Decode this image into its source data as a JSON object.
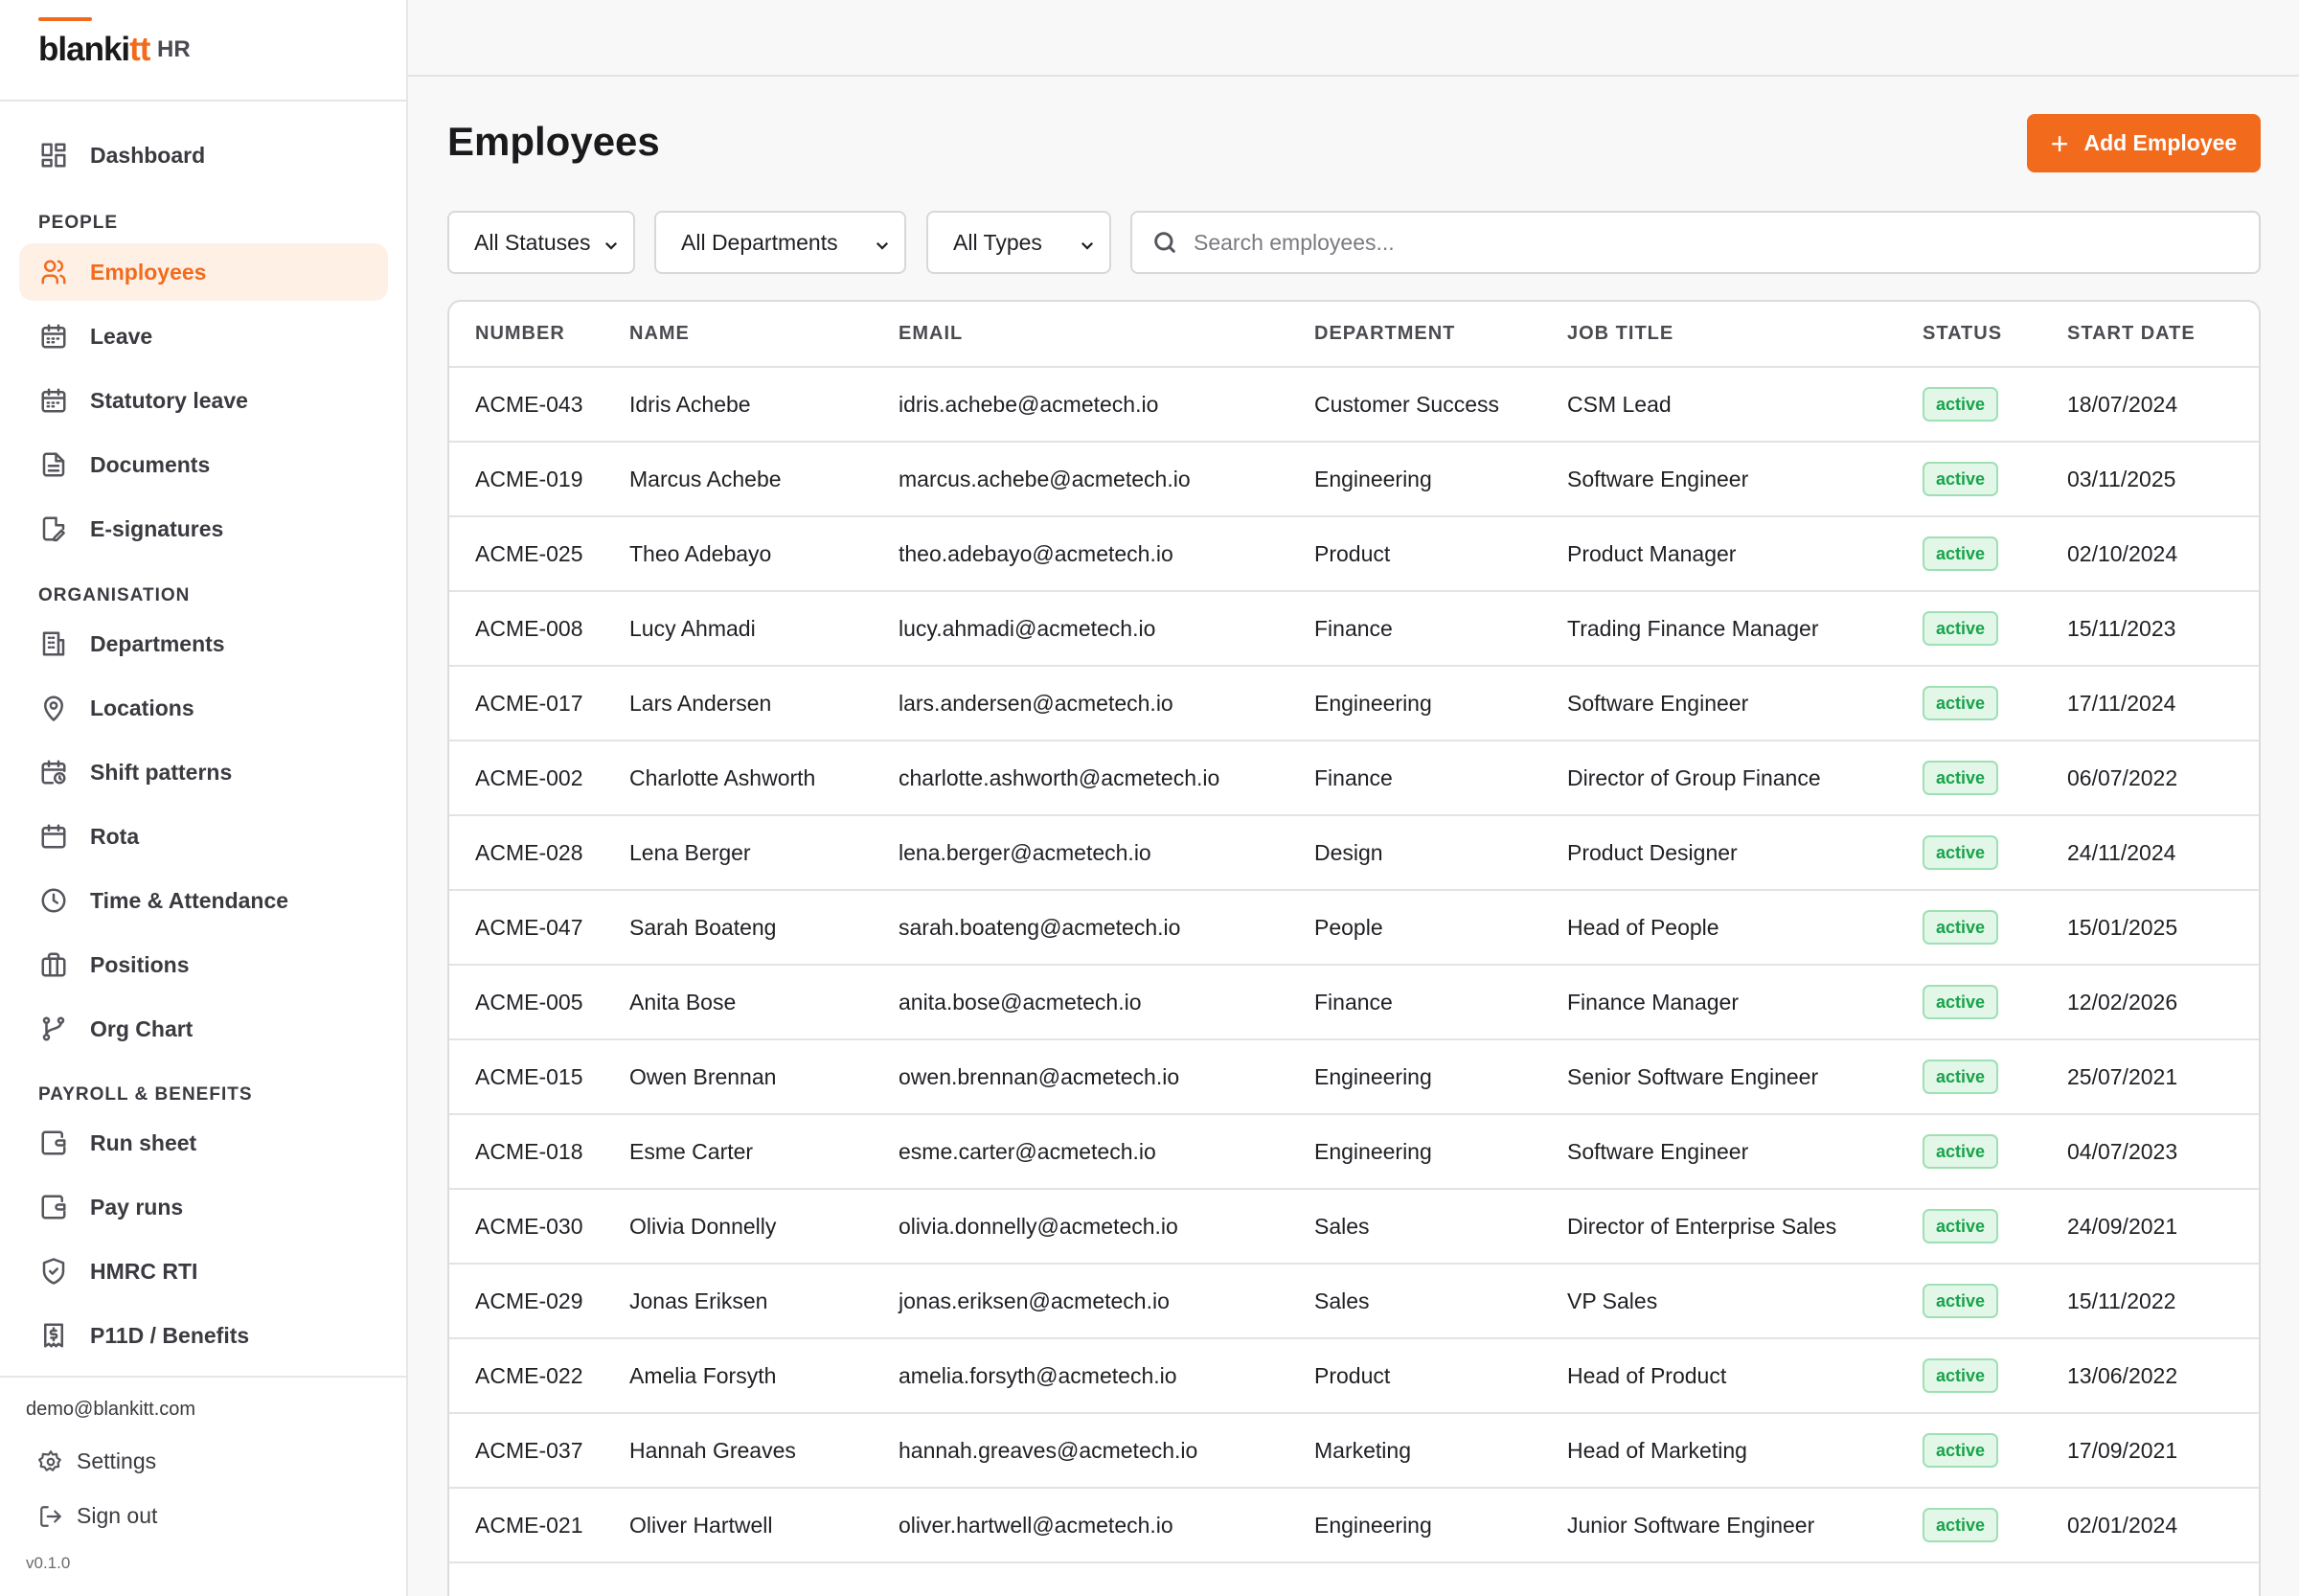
{
  "brand": {
    "logo_main": "blanki",
    "logo_accent": "tt",
    "suffix": "HR"
  },
  "sidebar": {
    "dashboard": "Dashboard",
    "sections": {
      "people": "PEOPLE",
      "organisation": "ORGANISATION",
      "payroll": "PAYROLL & BENEFITS"
    },
    "items": [
      {
        "label": "Employees",
        "icon": "users-icon",
        "active": true
      },
      {
        "label": "Leave",
        "icon": "calendar-icon"
      },
      {
        "label": "Statutory leave",
        "icon": "calendar-icon"
      },
      {
        "label": "Documents",
        "icon": "document-icon"
      },
      {
        "label": "E-signatures",
        "icon": "signature-icon"
      },
      {
        "label": "Departments",
        "icon": "building-icon"
      },
      {
        "label": "Locations",
        "icon": "map-pin-icon"
      },
      {
        "label": "Shift patterns",
        "icon": "calendar-clock-icon"
      },
      {
        "label": "Rota",
        "icon": "calendar-icon"
      },
      {
        "label": "Time & Attendance",
        "icon": "clock-icon"
      },
      {
        "label": "Positions",
        "icon": "briefcase-icon"
      },
      {
        "label": "Org Chart",
        "icon": "git-branch-icon"
      },
      {
        "label": "Run sheet",
        "icon": "wallet-icon"
      },
      {
        "label": "Pay runs",
        "icon": "wallet-icon"
      },
      {
        "label": "HMRC RTI",
        "icon": "shield-check-icon"
      },
      {
        "label": "P11D / Benefits",
        "icon": "receipt-icon"
      }
    ],
    "user_email": "demo@blankitt.com",
    "settings": "Settings",
    "sign_out": "Sign out",
    "version": "v0.1.0"
  },
  "main": {
    "title": "Employees",
    "add_button": "Add Employee",
    "filters": {
      "status": "All Statuses",
      "department": "All Departments",
      "type": "All Types"
    },
    "search_placeholder": "Search employees...",
    "columns": [
      "NUMBER",
      "NAME",
      "EMAIL",
      "DEPARTMENT",
      "JOB TITLE",
      "STATUS",
      "START DATE"
    ],
    "rows": [
      [
        "ACME-043",
        "Idris Achebe",
        "idris.achebe@acmetech.io",
        "Customer Success",
        "CSM Lead",
        "active",
        "18/07/2024"
      ],
      [
        "ACME-019",
        "Marcus Achebe",
        "marcus.achebe@acmetech.io",
        "Engineering",
        "Software Engineer",
        "active",
        "03/11/2025"
      ],
      [
        "ACME-025",
        "Theo Adebayo",
        "theo.adebayo@acmetech.io",
        "Product",
        "Product Manager",
        "active",
        "02/10/2024"
      ],
      [
        "ACME-008",
        "Lucy Ahmadi",
        "lucy.ahmadi@acmetech.io",
        "Finance",
        "Trading Finance Manager",
        "active",
        "15/11/2023"
      ],
      [
        "ACME-017",
        "Lars Andersen",
        "lars.andersen@acmetech.io",
        "Engineering",
        "Software Engineer",
        "active",
        "17/11/2024"
      ],
      [
        "ACME-002",
        "Charlotte Ashworth",
        "charlotte.ashworth@acmetech.io",
        "Finance",
        "Director of Group Finance",
        "active",
        "06/07/2022"
      ],
      [
        "ACME-028",
        "Lena Berger",
        "lena.berger@acmetech.io",
        "Design",
        "Product Designer",
        "active",
        "24/11/2024"
      ],
      [
        "ACME-047",
        "Sarah Boateng",
        "sarah.boateng@acmetech.io",
        "People",
        "Head of People",
        "active",
        "15/01/2025"
      ],
      [
        "ACME-005",
        "Anita Bose",
        "anita.bose@acmetech.io",
        "Finance",
        "Finance Manager",
        "active",
        "12/02/2026"
      ],
      [
        "ACME-015",
        "Owen Brennan",
        "owen.brennan@acmetech.io",
        "Engineering",
        "Senior Software Engineer",
        "active",
        "25/07/2021"
      ],
      [
        "ACME-018",
        "Esme Carter",
        "esme.carter@acmetech.io",
        "Engineering",
        "Software Engineer",
        "active",
        "04/07/2023"
      ],
      [
        "ACME-030",
        "Olivia Donnelly",
        "olivia.donnelly@acmetech.io",
        "Sales",
        "Director of Enterprise Sales",
        "active",
        "24/09/2021"
      ],
      [
        "ACME-029",
        "Jonas Eriksen",
        "jonas.eriksen@acmetech.io",
        "Sales",
        "VP Sales",
        "active",
        "15/11/2022"
      ],
      [
        "ACME-022",
        "Amelia Forsyth",
        "amelia.forsyth@acmetech.io",
        "Product",
        "Head of Product",
        "active",
        "13/06/2022"
      ],
      [
        "ACME-037",
        "Hannah Greaves",
        "hannah.greaves@acmetech.io",
        "Marketing",
        "Head of Marketing",
        "active",
        "17/09/2021"
      ],
      [
        "ACME-021",
        "Oliver Hartwell",
        "oliver.hartwell@acmetech.io",
        "Engineering",
        "Junior Software Engineer",
        "active",
        "02/01/2024"
      ]
    ]
  },
  "colors": {
    "accent": "#f26b1d",
    "active_bg": "#fff0e6",
    "badge_bg": "#e3f7e9",
    "badge_text": "#18a34a"
  }
}
